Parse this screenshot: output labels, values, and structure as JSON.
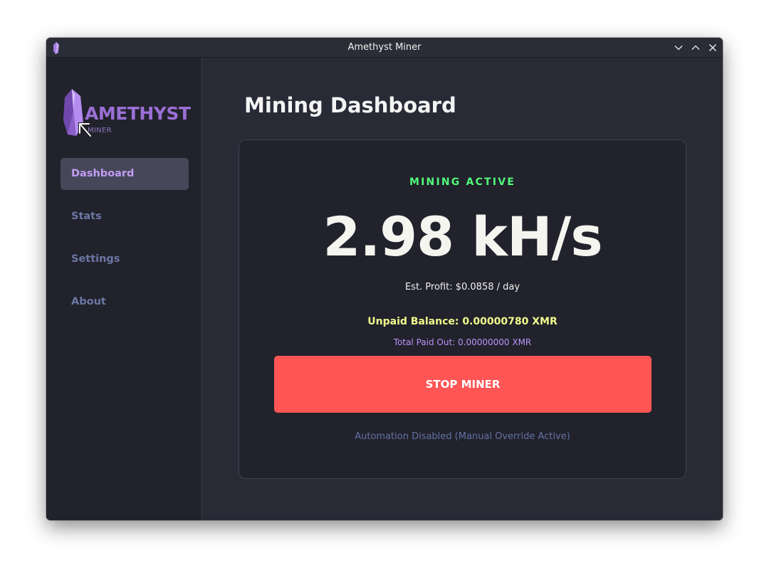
{
  "window": {
    "title": "Amethyst Miner",
    "controls": [
      "minimize",
      "maximize",
      "close"
    ]
  },
  "sidebar": {
    "logo": {
      "word": "AMETHYST",
      "sub": "MINER"
    },
    "items": [
      {
        "label": "Dashboard",
        "active": true
      },
      {
        "label": "Stats",
        "active": false
      },
      {
        "label": "Settings",
        "active": false
      },
      {
        "label": "About",
        "active": false
      }
    ]
  },
  "main": {
    "title": "Mining Dashboard",
    "card": {
      "status": "MINING ACTIVE",
      "hashrate": "2.98 kH/s",
      "profit": "Est. Profit: $0.0858 / day",
      "unpaid": "Unpaid Balance: 0.00000780 XMR",
      "paid": "Total Paid Out: 0.00000000 XMR",
      "stop_label": "STOP MINER",
      "automation": "Automation Disabled (Manual Override Active)"
    }
  },
  "colors": {
    "accent": "#bd93f9",
    "active_green": "#50fa7b",
    "balance_yellow": "#f1fa8c",
    "stop_red": "#ff5555",
    "muted_blue": "#6272a4",
    "sidebar_bg": "#21222b",
    "main_bg": "#282a36"
  },
  "icons": {
    "app": "amethyst-crystal-icon",
    "minimize": "chevron-down-icon",
    "maximize": "chevron-up-icon",
    "close": "close-icon",
    "cursor": "mouse-cursor-icon"
  }
}
